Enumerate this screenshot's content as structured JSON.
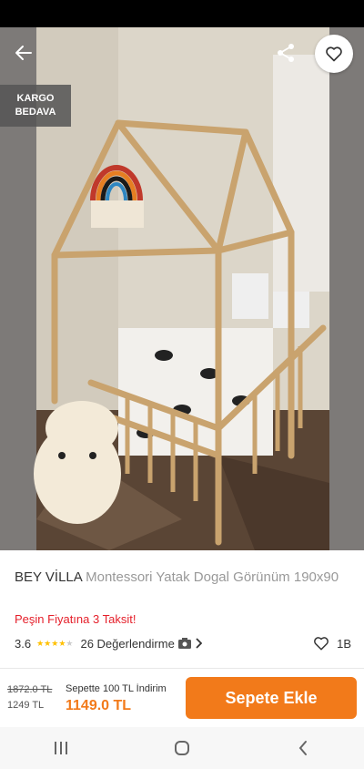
{
  "gallery": {
    "badge": {
      "line1": "KARGO",
      "line2": "BEDAVA"
    },
    "dot_count": 5,
    "active_dot": 1
  },
  "product": {
    "brand": "BEY VİLLA",
    "name": "Montessori Yatak Dogal Görünüm 190x90",
    "installment_text": "Peşin Fiyatına 3 Taksit!",
    "rating": "3.6",
    "rating_value": 3.6,
    "reviews_label": "26 Değerlendirme",
    "likes": "1B"
  },
  "buy_bar": {
    "old_price": "1872.0 TL",
    "cart_price": "1249 TL",
    "promo": "Sepette 100 TL İndirim",
    "new_price": "1149.0 TL",
    "add_to_cart_label": "Sepete Ekle"
  },
  "colors": {
    "accent": "#f27a1a",
    "installment": "#e5202b",
    "star": "#ffc000"
  },
  "icons": {
    "back": "back-arrow-icon",
    "share": "share-icon",
    "favorite": "heart-icon",
    "camera": "camera-icon",
    "chevron": "chevron-right-icon",
    "nav_recents": "recents-icon",
    "nav_home": "home-icon",
    "nav_back": "nav-back-icon"
  }
}
